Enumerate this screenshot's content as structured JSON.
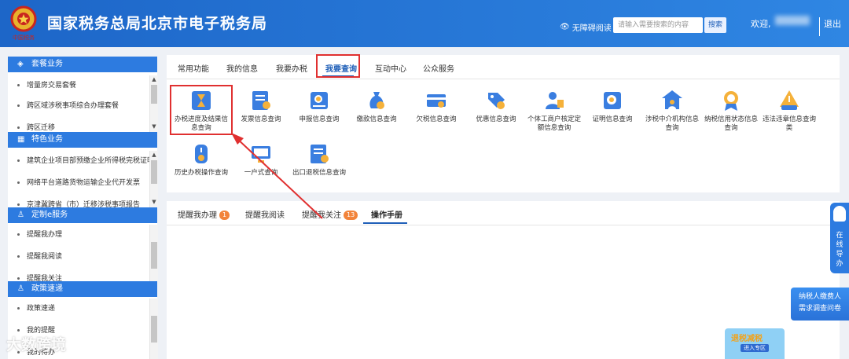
{
  "header": {
    "title": "国家税务总局北京市电子税务局",
    "emblem_text": "中国税务",
    "accessibility": "无障碍阅读",
    "search_placeholder": "请输入需要搜索的内容",
    "search_button": "搜索",
    "welcome": "欢迎,",
    "logout": "退出"
  },
  "sidebar": {
    "sections": [
      {
        "title": "套餐业务",
        "icon": "layers-icon",
        "items": [
          "增量房交易套餐",
          "跨区域涉税事项综合办理套餐",
          "跨区迁移"
        ]
      },
      {
        "title": "特色业务",
        "icon": "grid-icon",
        "items": [
          "建筑企业项目部预缴企业所得税完税证明...",
          "网络平台道路货物运输企业代开发票",
          "京津冀跨省（市）迁移涉税事项报告"
        ]
      },
      {
        "title": "定制e服务",
        "icon": "user-icon",
        "items": [
          "提醒我办理",
          "提醒我阅读",
          "提醒我关注"
        ]
      },
      {
        "title": "政策速递",
        "icon": "user-icon",
        "items": [
          "政策速递",
          "我的提醒",
          "我的待办"
        ]
      }
    ]
  },
  "tabs": [
    "常用功能",
    "我的信息",
    "我要办税",
    "我要查询",
    "互动中心",
    "公众服务"
  ],
  "active_tab": "我要查询",
  "query_items": [
    {
      "label": "办税进度及结果信息查询",
      "icon": "hourglass-icon"
    },
    {
      "label": "发票信息查询",
      "icon": "invoice-search-icon"
    },
    {
      "label": "申报信息查询",
      "icon": "declaration-search-icon"
    },
    {
      "label": "缴款信息查询",
      "icon": "money-bag-icon"
    },
    {
      "label": "欠税信息查询",
      "icon": "card-search-icon"
    },
    {
      "label": "优惠信息查询",
      "icon": "discount-tag-icon"
    },
    {
      "label": "个体工商户核定定额信息查询",
      "icon": "person-doc-icon"
    },
    {
      "label": "证明信息查询",
      "icon": "certificate-search-icon"
    },
    {
      "label": "涉税中介机构信息查询",
      "icon": "agency-icon"
    },
    {
      "label": "纳税信用状态信息查询",
      "icon": "medal-icon"
    },
    {
      "label": "违法违章信息查询类",
      "icon": "warning-person-icon"
    },
    {
      "label": "历史办税操作查询",
      "icon": "history-icon"
    },
    {
      "label": "一户式查询",
      "icon": "monitor-icon"
    },
    {
      "label": "出口退税信息查询",
      "icon": "export-refund-icon"
    }
  ],
  "bottom_tabs": [
    {
      "label": "提醒我办理",
      "badge": "1"
    },
    {
      "label": "提醒我阅读",
      "badge": ""
    },
    {
      "label": "提醒我关注",
      "badge": "13"
    },
    {
      "label": "操作手册",
      "badge": ""
    }
  ],
  "float": {
    "guide": "在线导办",
    "survey_line1": "纳税人缴费人",
    "survey_line2": "需求调查问卷",
    "promo_title": "退税减税",
    "promo_button": "进入专区"
  },
  "watermark": "大数跨境",
  "colors": {
    "brand": "#2d7be0",
    "highlight": "#e03030",
    "badge": "#f2843b"
  }
}
